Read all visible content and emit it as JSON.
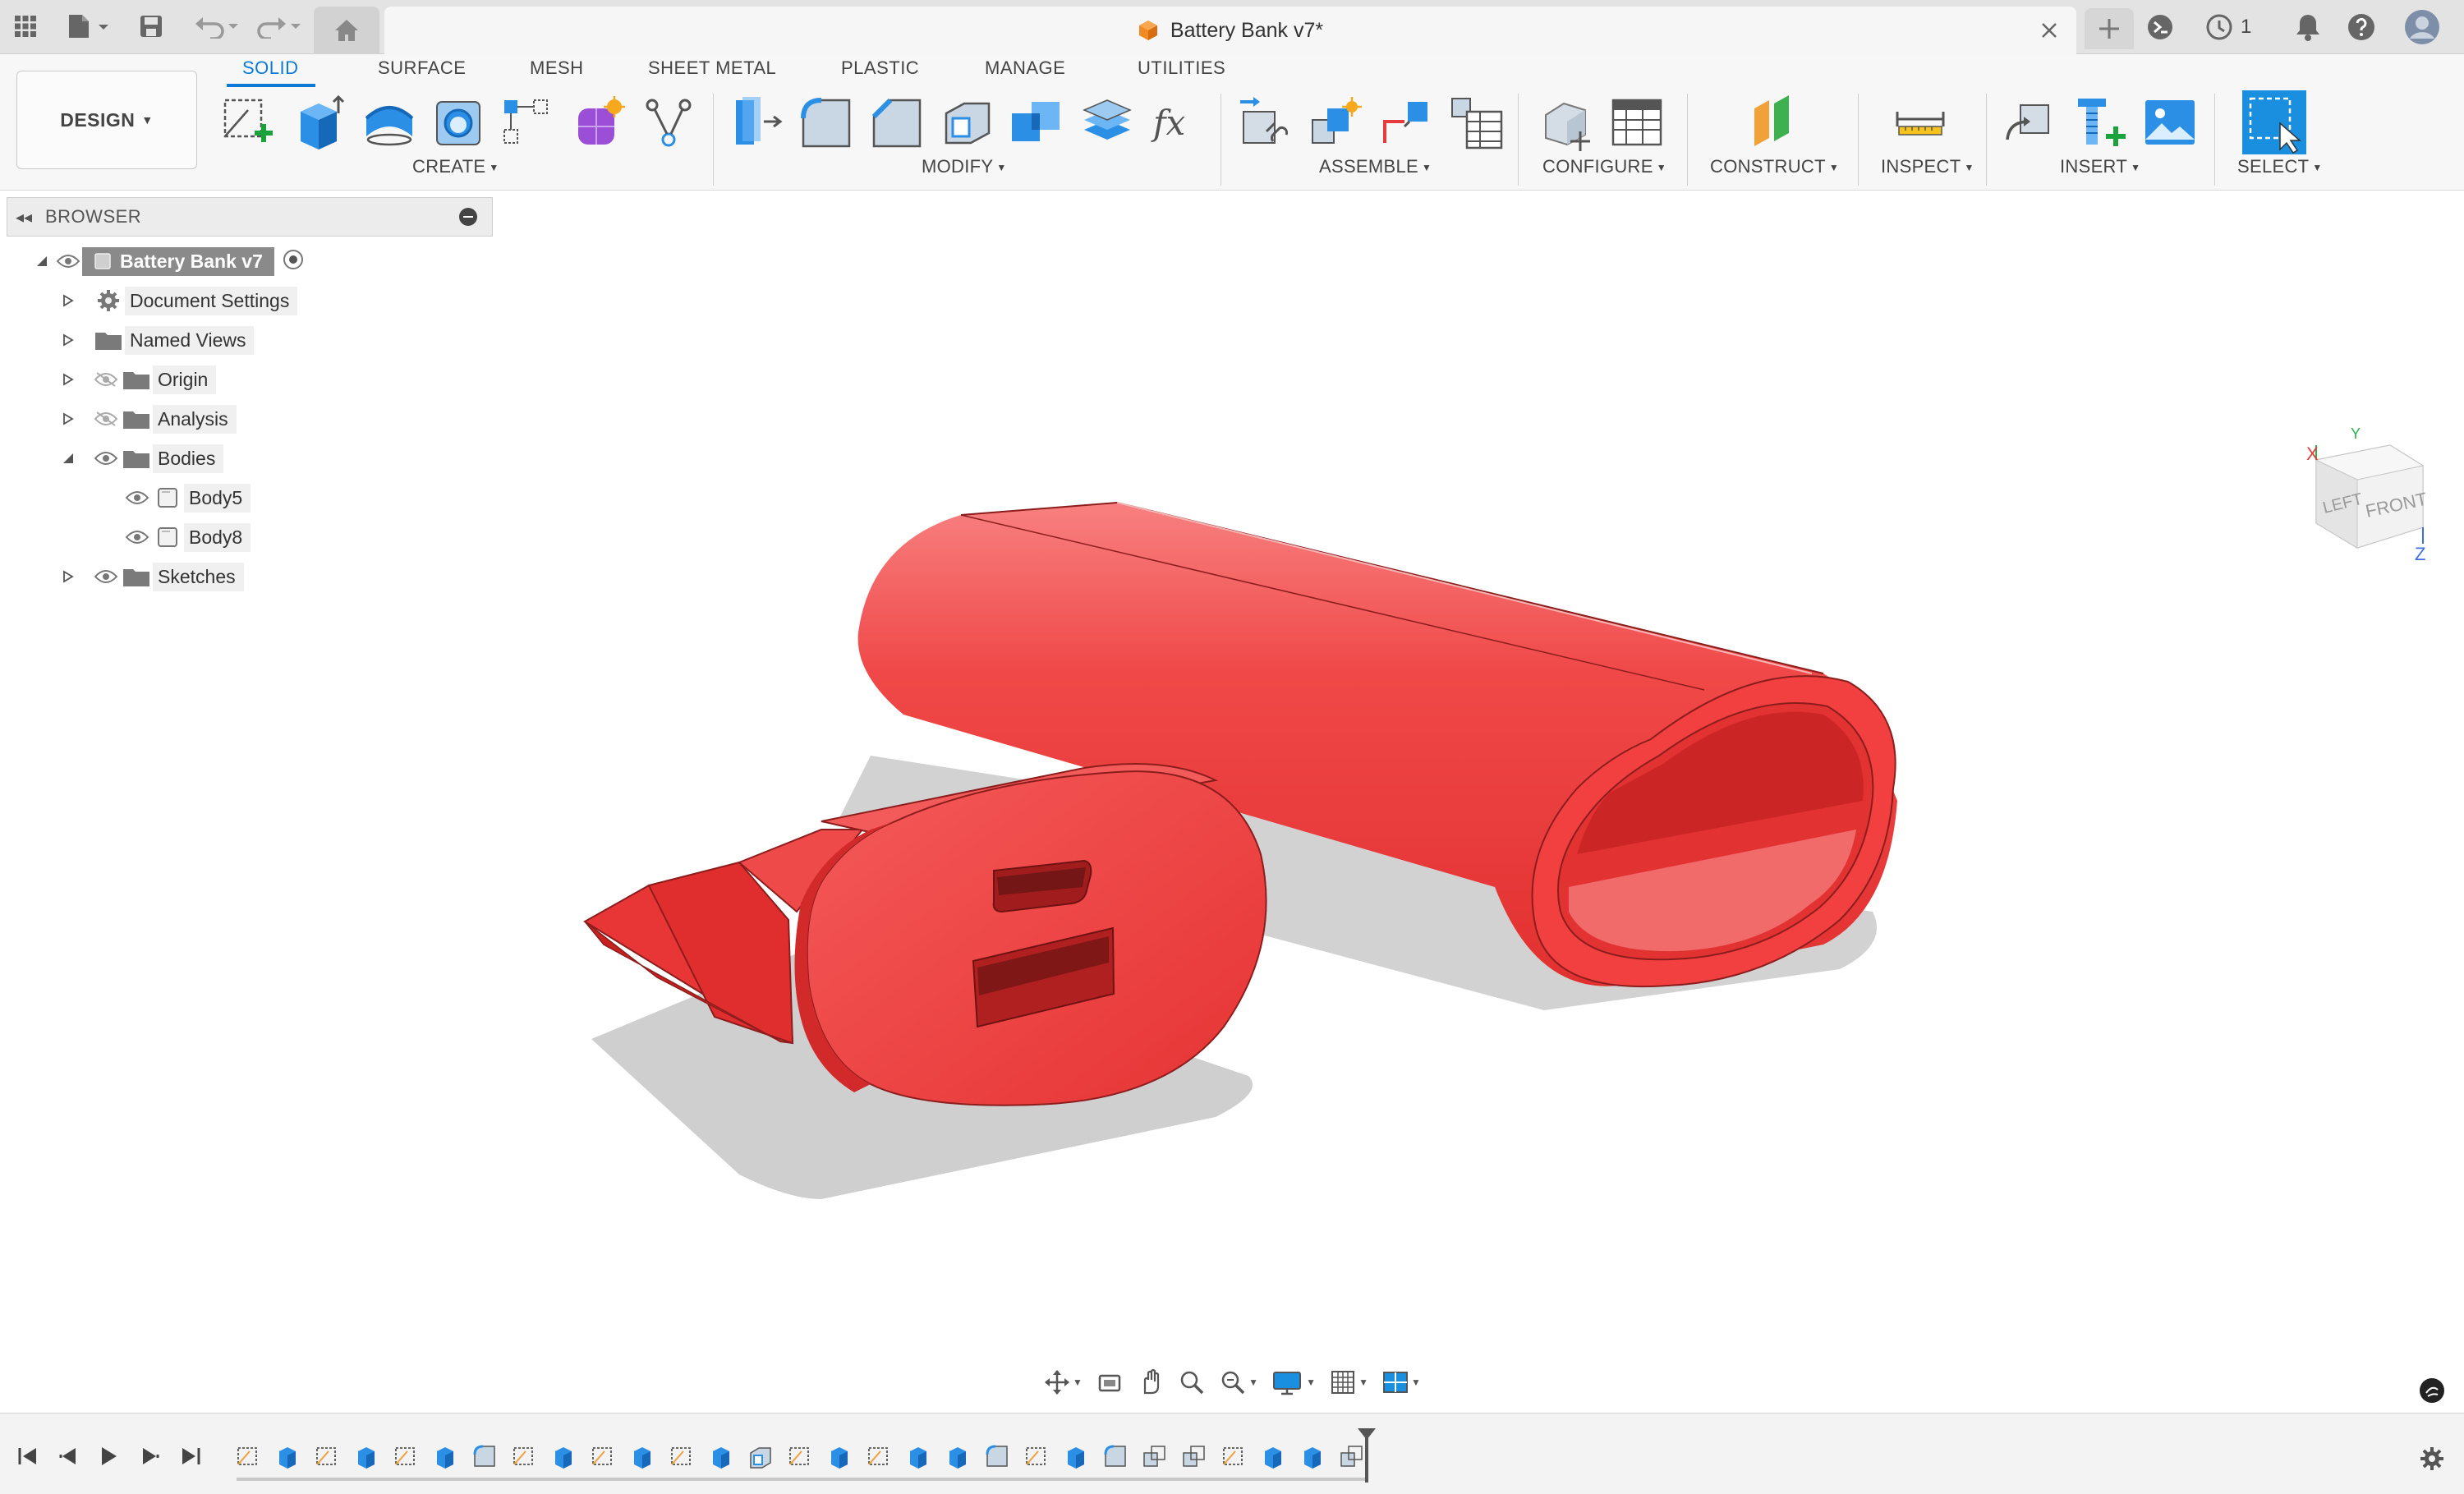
{
  "app": {
    "document_title": "Battery Bank v7*",
    "jobs_count": "1"
  },
  "toolbar": {
    "workspace_button": "DESIGN",
    "tabs": [
      "SOLID",
      "SURFACE",
      "MESH",
      "SHEET METAL",
      "PLASTIC",
      "MANAGE",
      "UTILITIES"
    ],
    "active_tab": "SOLID",
    "groups": {
      "create": "CREATE",
      "modify": "MODIFY",
      "assemble": "ASSEMBLE",
      "configure": "CONFIGURE",
      "construct": "CONSTRUCT",
      "inspect": "INSPECT",
      "insert": "INSERT",
      "select": "SELECT"
    }
  },
  "browser": {
    "title": "BROWSER",
    "root": "Battery Bank v7",
    "items": [
      {
        "label": "Document Settings",
        "icon": "gear-icon"
      },
      {
        "label": "Named Views",
        "icon": "folder-icon"
      },
      {
        "label": "Origin",
        "icon": "folder-icon",
        "hidden": true
      },
      {
        "label": "Analysis",
        "icon": "folder-icon",
        "hidden": true
      },
      {
        "label": "Bodies",
        "icon": "folder-icon",
        "expanded": true
      },
      {
        "label": "Body5",
        "icon": "body-icon"
      },
      {
        "label": "Body8",
        "icon": "body-icon"
      },
      {
        "label": "Sketches",
        "icon": "folder-icon"
      }
    ]
  },
  "viewcube": {
    "left_face": "LEFT",
    "front_face": "FRONT",
    "axis_x": "X",
    "axis_y": "Y",
    "axis_z": "Z"
  },
  "colors": {
    "accent": "#0c7bd6",
    "body_red": "#ee3b3b",
    "select_blue": "#1b8fdf"
  }
}
